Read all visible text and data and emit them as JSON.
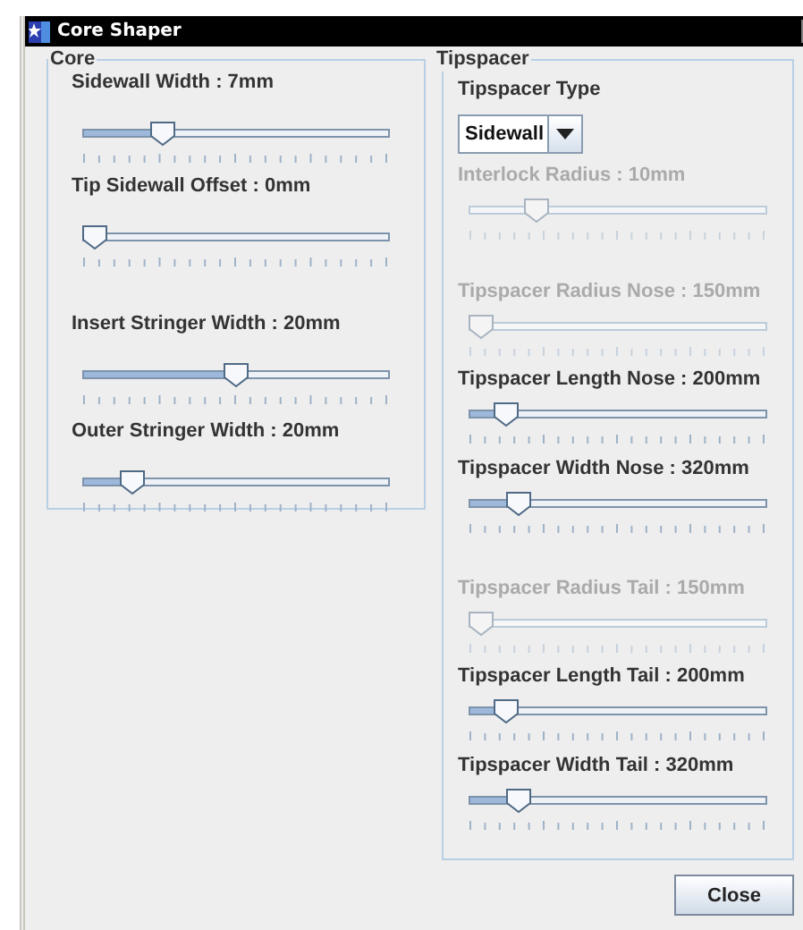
{
  "window": {
    "title": "Core Shaper"
  },
  "core": {
    "title": "Core",
    "sliders": [
      {
        "label": "Sidewall Width : 7mm",
        "level": 0.24,
        "disabled": false
      },
      {
        "label": "Tip Sidewall Offset : 0mm",
        "level": 0,
        "disabled": false
      },
      {
        "label": "Insert Stringer Width : 20mm",
        "level": 0.5,
        "disabled": false
      },
      {
        "label": "Outer Stringer Width : 20mm",
        "level": 0.13,
        "disabled": false
      }
    ]
  },
  "tipspacer": {
    "title": "Tipspacer",
    "type_label": "Tipspacer Type",
    "type_value": "Sidewall",
    "sliders": [
      {
        "label": "Interlock Radius : 10mm",
        "level": 0.2,
        "disabled": true
      },
      {
        "label": "Tipspacer Radius Nose : 150mm",
        "level": 0,
        "disabled": true
      },
      {
        "label": "Tipspacer Length Nose : 200mm",
        "level": 0.09,
        "disabled": false
      },
      {
        "label": "Tipspacer Width Nose : 320mm",
        "level": 0.14,
        "disabled": false
      },
      {
        "label": "Tipspacer Radius Tail : 150mm",
        "level": 0,
        "disabled": true
      },
      {
        "label": "Tipspacer Length Tail : 200mm",
        "level": 0.09,
        "disabled": false
      },
      {
        "label": "Tipspacer Width Tail : 320mm",
        "level": 0.14,
        "disabled": false
      }
    ]
  },
  "buttons": [
    "Close"
  ]
}
